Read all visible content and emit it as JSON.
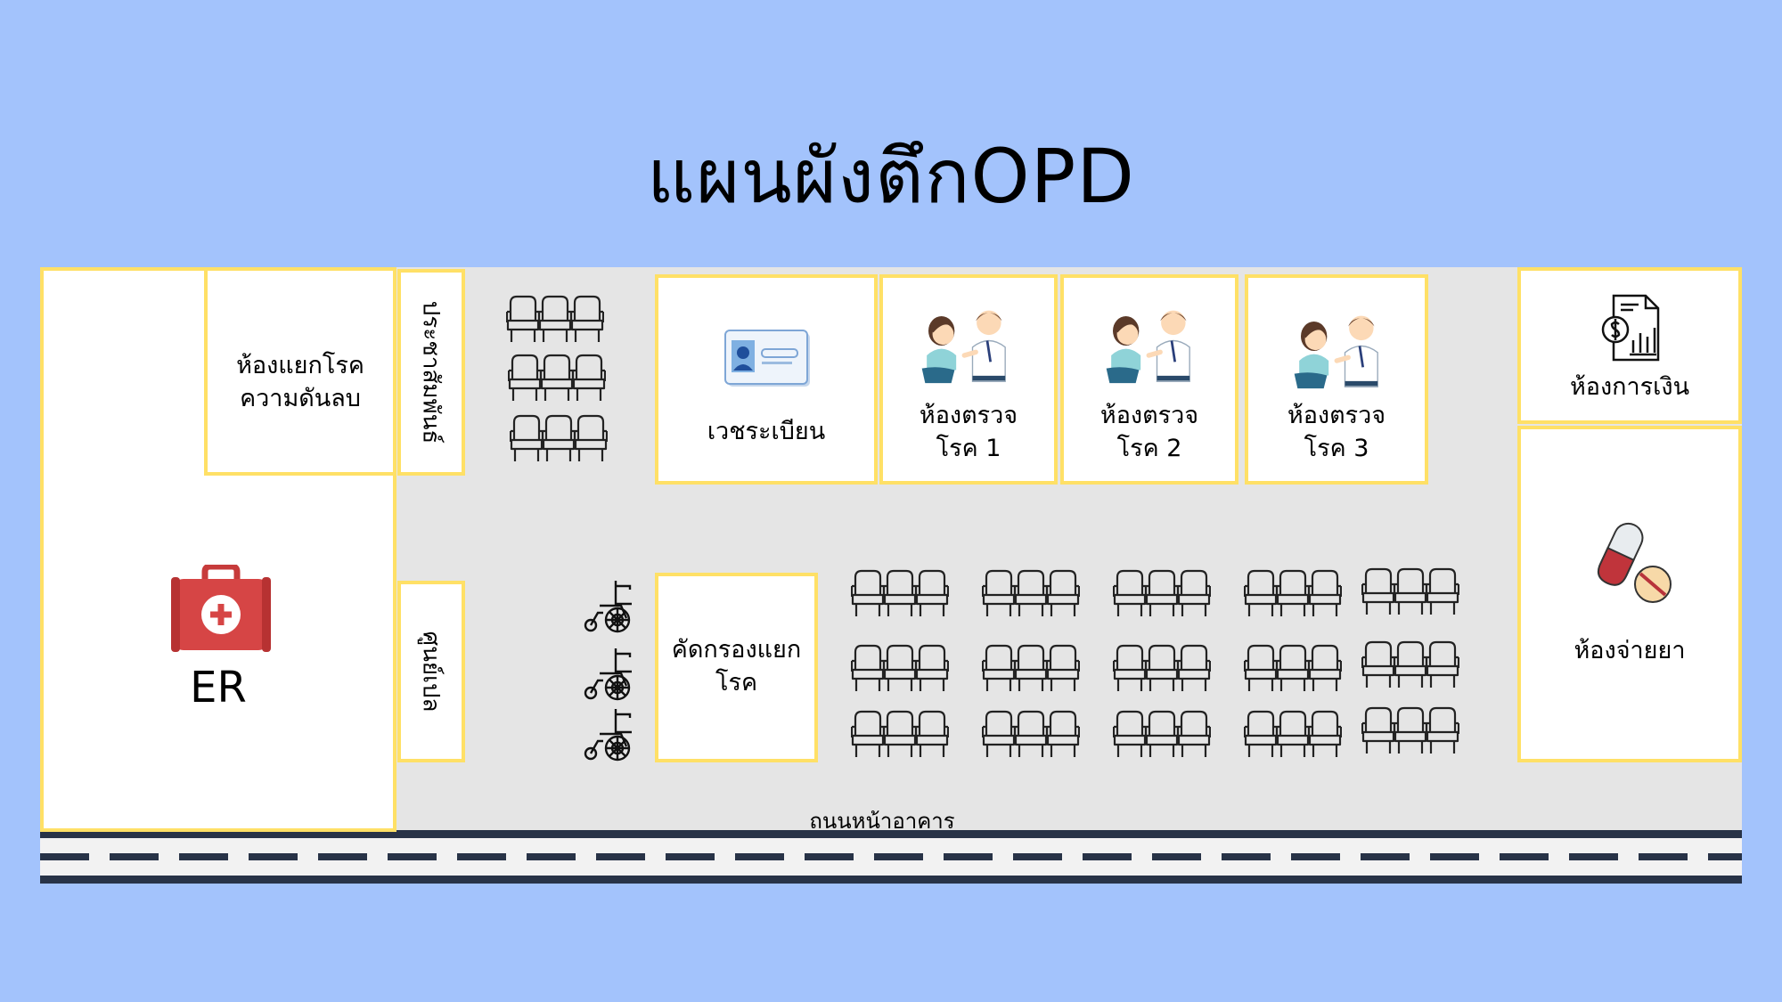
{
  "title": "แผนผังตึกOPD",
  "rooms": {
    "er": "ER",
    "isolation": "ห้องแยกโรค\nความดันลบ",
    "pr": "ประชาสัมพันธ์",
    "sun": "ศูนย์เปล",
    "records": "เวชระเบียน",
    "exam1": "ห้องตรวจ\nโรค 1",
    "exam2": "ห้องตรวจ\nโรค 2",
    "exam3": "ห้องตรวจ\nโรค 3",
    "screening": "คัดกรองแยก\nโรค",
    "finance": "ห้องการเงิน",
    "pharmacy": "ห้องจ่ายยา"
  },
  "road_label": "ถนนหน้าอาคาร",
  "icons": {
    "er": "first-aid-kit-icon",
    "records": "id-card-icon",
    "exam": "doctor-patient-consultation-icon",
    "finance": "financial-report-icon",
    "pharmacy": "pill-icon",
    "seat": "waiting-chairs-icon",
    "wheelchair": "wheelchair-icon"
  },
  "colors": {
    "background": "#a3c3fc",
    "floor": "#e5e5e5",
    "room_border": "#ffe066",
    "road_line": "#283347",
    "first_aid": "#d64545"
  }
}
